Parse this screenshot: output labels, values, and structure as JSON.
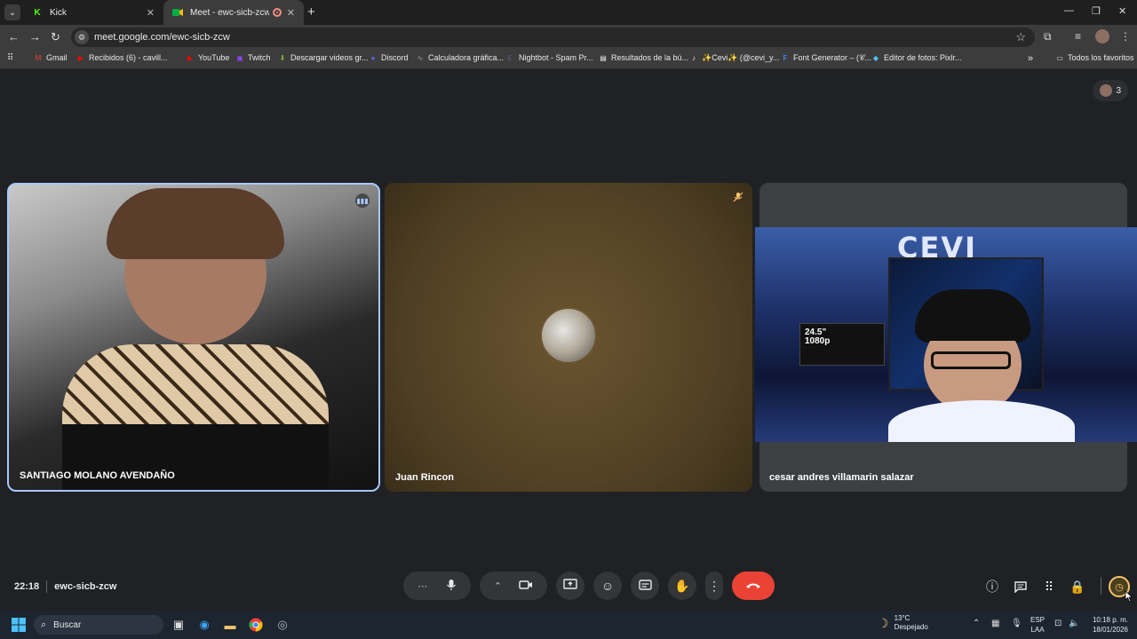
{
  "browser": {
    "tabs": [
      {
        "title": "Kick",
        "favicon": "kick-icon",
        "active": false
      },
      {
        "title": "Meet - ewc-sicb-zcw",
        "favicon": "meet-icon",
        "active": true,
        "recording": true
      }
    ],
    "url": "meet.google.com/ewc-sicb-zcw",
    "bookmarks": [
      {
        "label": "Gmail",
        "icon": "gmail-icon",
        "color": "#ea4335"
      },
      {
        "label": "Recibidos (6) - cavill...",
        "icon": "youtube-icon",
        "color": "#ff0000"
      },
      {
        "label": "YouTube",
        "icon": "youtube-icon",
        "color": "#ff0000"
      },
      {
        "label": "Twitch",
        "icon": "twitch-icon",
        "color": "#9146ff"
      },
      {
        "label": "Descargar videos gr...",
        "icon": "download-icon",
        "color": "#7cb342"
      },
      {
        "label": "Discord",
        "icon": "discord-icon",
        "color": "#5865f2"
      },
      {
        "label": "Calculadora gráfica...",
        "icon": "chart-icon",
        "color": "#9e9e9e"
      },
      {
        "label": "Nightbot - Spam Pr...",
        "icon": "nightbot-icon",
        "color": "#7986cb"
      },
      {
        "label": "Resultados de la bú...",
        "icon": "document-icon",
        "color": "#e8eaed"
      },
      {
        "label": "✨Cevi✨ (@cevi_y...",
        "icon": "tiktok-icon",
        "color": "#e8eaed"
      },
      {
        "label": "Font Generator – (𝒞...",
        "icon": "font-icon",
        "color": "#4285f4"
      },
      {
        "label": "Editor de fotos: Pixlr...",
        "icon": "pixlr-icon",
        "color": "#4fc3f7"
      }
    ],
    "all_bookmarks_label": "Todos los favoritos"
  },
  "meet": {
    "participant_count": "3",
    "tiles": [
      {
        "name": "SANTIAGO MOLANO AVENDAÑO",
        "status": "speaking"
      },
      {
        "name": "Juan Rincon",
        "status": "muted"
      },
      {
        "name": "cesar andres villamarin salazar",
        "status": "video"
      }
    ],
    "video_overlay": {
      "brand": "CEVI",
      "monitor_text_1": "24.5\"",
      "monitor_text_2": "1080p"
    },
    "time": "22:18",
    "meeting_code": "ewc-sicb-zcw",
    "accent_end_call": "#ea4335",
    "accent_speaking": "#a8c7fa"
  },
  "taskbar": {
    "search_placeholder": "Buscar",
    "weather_temp": "13°C",
    "weather_desc": "Despejado",
    "lang_1": "ESP",
    "lang_2": "LAA",
    "clock_time": "10:18 p. m.",
    "clock_date": "18/01/2026"
  }
}
